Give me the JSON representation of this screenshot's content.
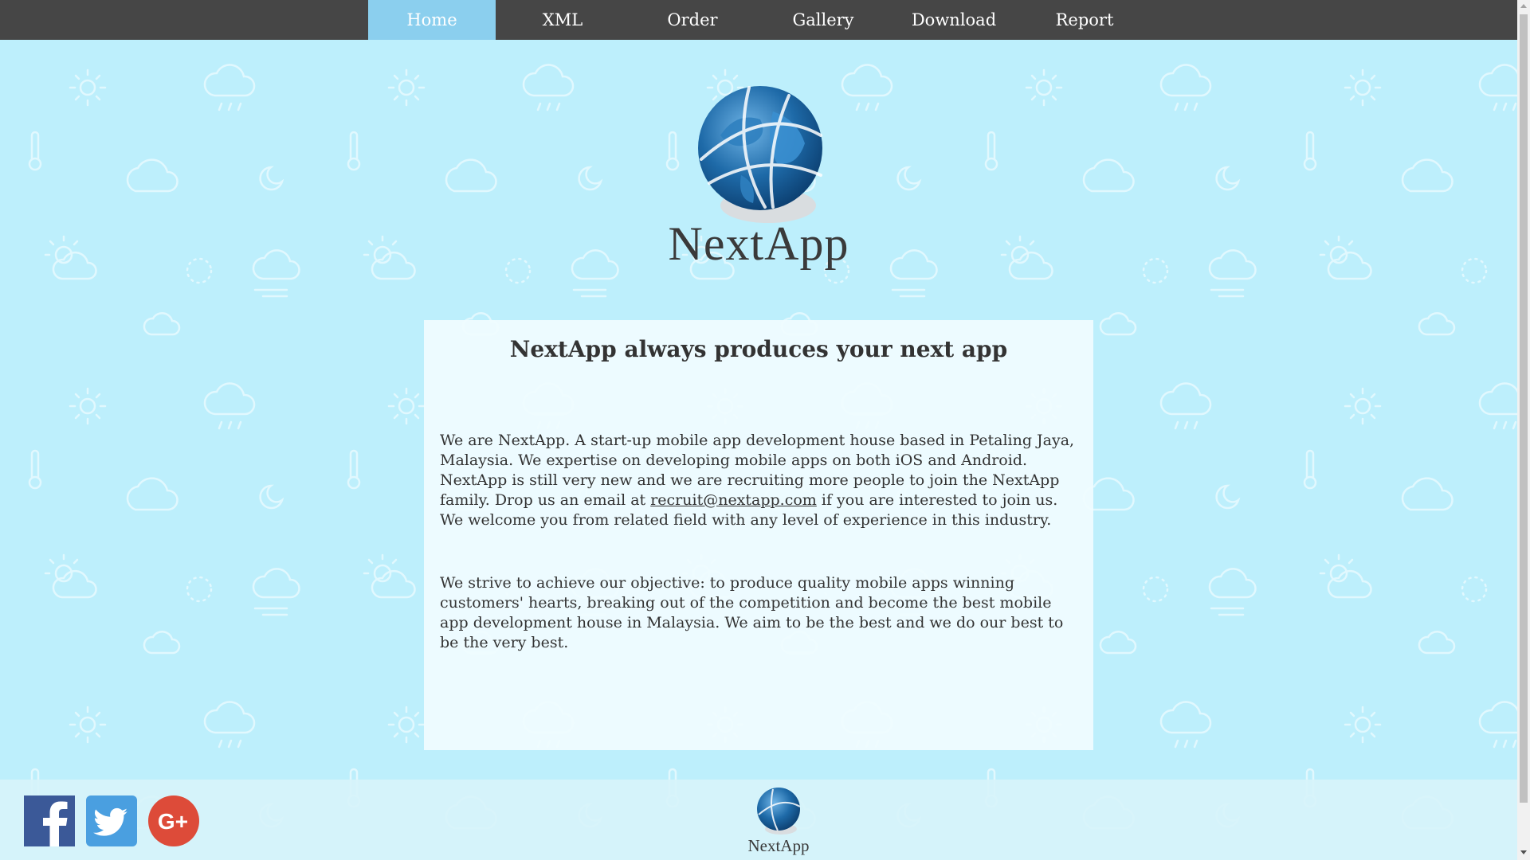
{
  "nav": {
    "items": [
      {
        "label": "Home",
        "active": true
      },
      {
        "label": "XML",
        "active": false
      },
      {
        "label": "Order",
        "active": false
      },
      {
        "label": "Gallery",
        "active": false
      },
      {
        "label": "Download",
        "active": false
      },
      {
        "label": "Report",
        "active": false
      }
    ]
  },
  "logo": {
    "text": "NextApp",
    "icon": "globe-icon"
  },
  "content": {
    "title": "NextApp always produces your next app",
    "paragraph1_before": "We are NextApp. A start-up mobile app development house based in Petaling Jaya, Malaysia. We expertise on developing mobile apps on both iOS and Android. NextApp is still very new and we are recruiting more people to join the NextApp family. Drop us an email at ",
    "email": "recruit@nextapp.com",
    "paragraph1_after": " if you are interested to join us. We welcome you from related field with any level of experience in this industry.",
    "paragraph2": "We strive to achieve our objective: to produce quality mobile apps winning customers' hearts, breaking out of the competition and become the best mobile app development house in Malaysia. We aim to be the best and we do our best to be the very best."
  },
  "footer": {
    "social": [
      {
        "name": "facebook-icon",
        "color": "#3b5998",
        "glyph": "f"
      },
      {
        "name": "twitter-icon",
        "color": "#55acee"
      },
      {
        "name": "google-plus-icon",
        "color": "#dd4b39",
        "glyph": "G+"
      }
    ],
    "logo_text": "NextApp"
  },
  "colors": {
    "nav_background": "#464646",
    "nav_active": "#8bcfee",
    "page_background": "#bdeffc"
  }
}
